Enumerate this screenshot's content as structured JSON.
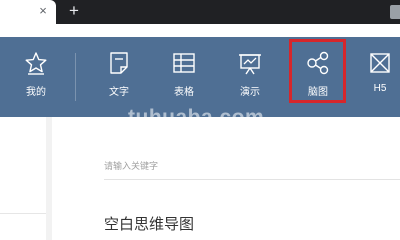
{
  "browser": {
    "tab_close": "×",
    "new_tab": "+"
  },
  "toolbar": {
    "items": [
      {
        "label": "我的",
        "icon": "star-icon"
      },
      {
        "label": "文字",
        "icon": "note-icon"
      },
      {
        "label": "表格",
        "icon": "table-icon"
      },
      {
        "label": "演示",
        "icon": "presentation-icon"
      },
      {
        "label": "脑图",
        "icon": "mindmap-icon",
        "highlighted": true
      },
      {
        "label": "H5",
        "icon": "envelope-icon"
      }
    ]
  },
  "watermark": "tuhuaba.com",
  "search": {
    "placeholder": "请输入关键字"
  },
  "main": {
    "blank_mindmap_label": "空白思维导图"
  },
  "colors": {
    "toolbar_bg": "#4f6f94",
    "highlight_border": "#d6262b",
    "tab_strip": "#202124"
  }
}
